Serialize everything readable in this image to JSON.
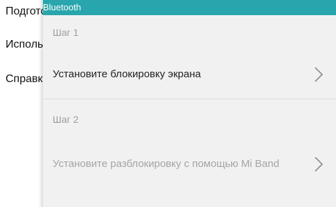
{
  "background": {
    "lines": [
      "Подготовка",
      "Использование",
      "Справка"
    ]
  },
  "sheet": {
    "header_title": "Bluetooth",
    "step1": {
      "label": "Шаг 1",
      "action": "Установите блокировку экрана"
    },
    "step2": {
      "label": "Шаг 2",
      "action": "Установите разблокировку с помощью Mi Band"
    }
  },
  "icons": {
    "chevron": "chevron-right-icon"
  },
  "colors": {
    "header": "#29a6ad",
    "sheet_bg": "#f1f1f1",
    "muted_text": "#9d9d9d",
    "primary_text": "#222222"
  }
}
